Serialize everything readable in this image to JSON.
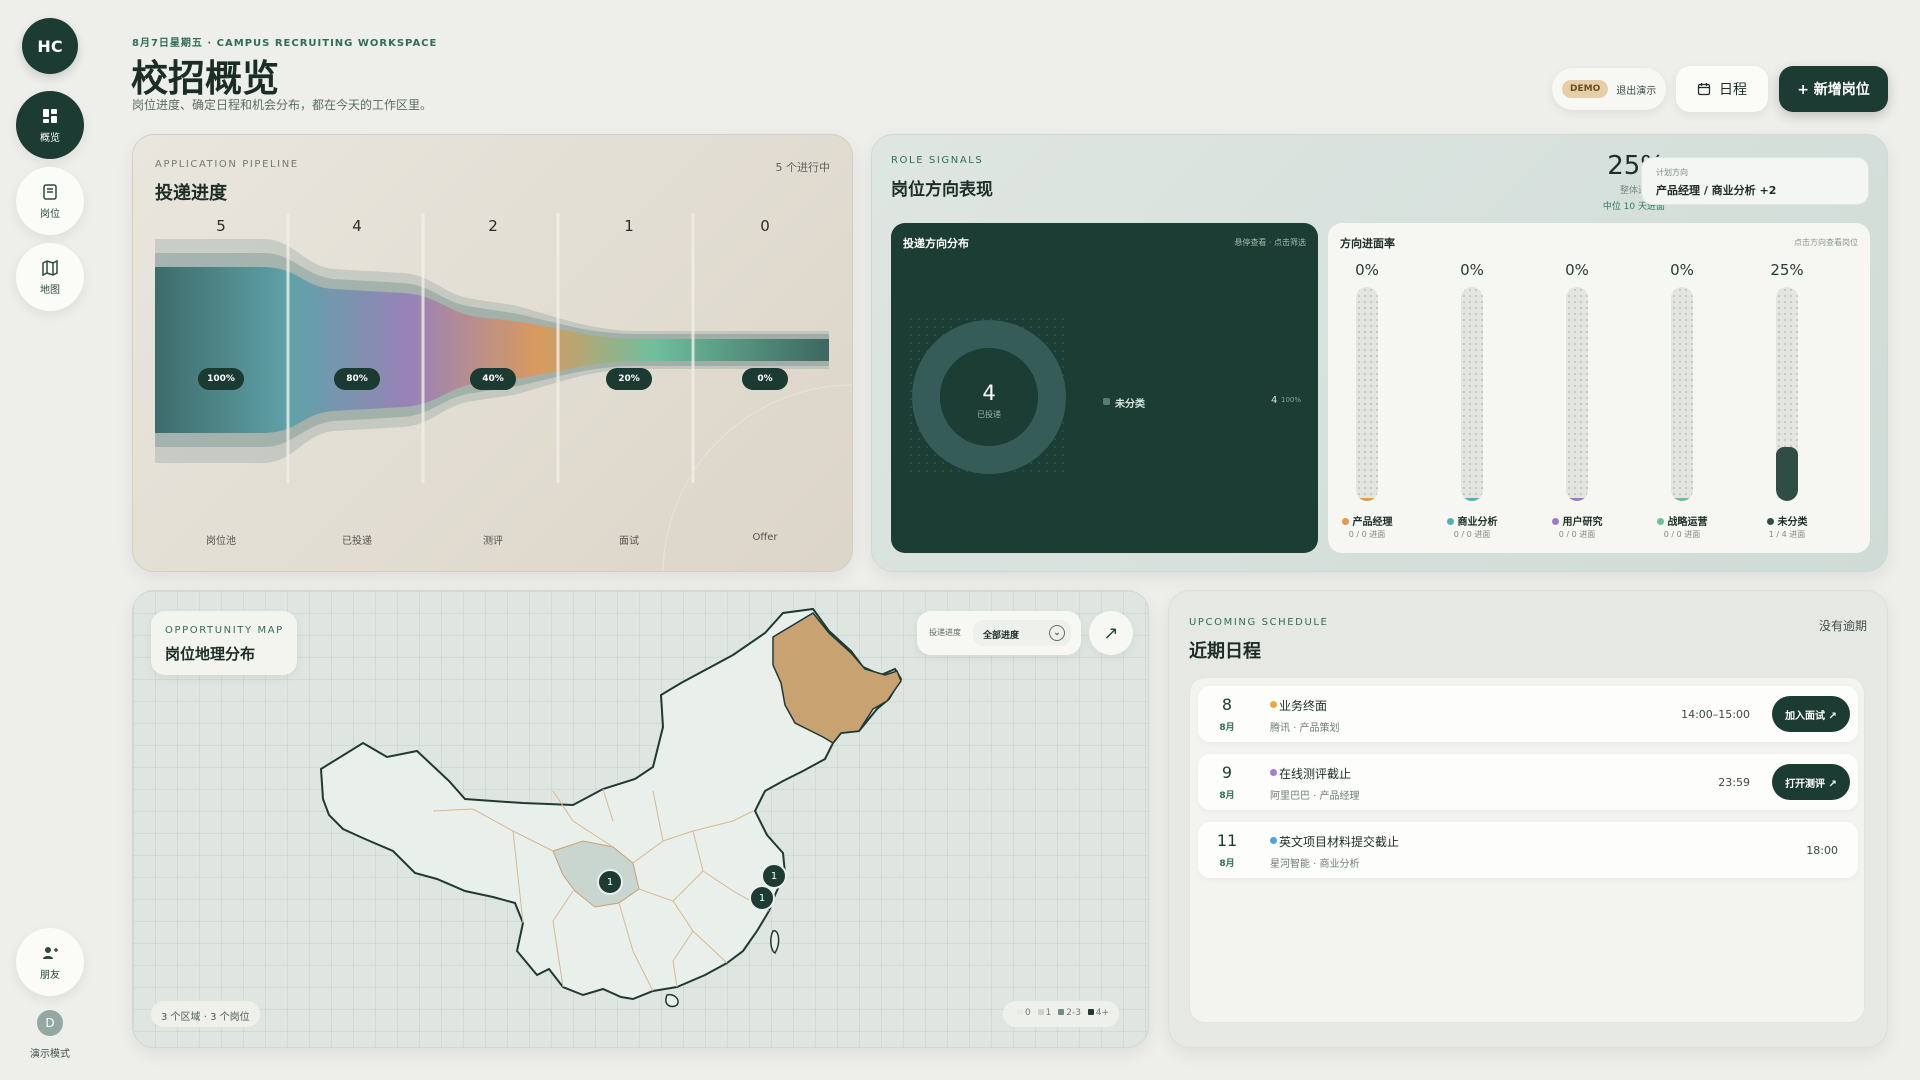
{
  "sidebar": {
    "logo": "HC",
    "items": [
      {
        "label": "概览",
        "icon": "dashboard-icon"
      },
      {
        "label": "岗位",
        "icon": "document-icon"
      },
      {
        "label": "地图",
        "icon": "map-icon"
      }
    ],
    "friends_label": "朋友",
    "user_initial": "D",
    "mode_label": "演示模式"
  },
  "header": {
    "eyebrow": "8月7日星期五 · CAMPUS RECRUITING WORKSPACE",
    "title": "校招概览",
    "subtitle": "岗位进度、确定日程和机会分布，都在今天的工作区里。",
    "demo_badge": "DEMO",
    "demo_exit": "退出演示",
    "schedule_btn": "日程",
    "new_btn": "+ 新增岗位"
  },
  "pipeline": {
    "kicker": "APPLICATION PIPELINE",
    "title": "投递进度",
    "status": "5 个进行中",
    "stages": [
      {
        "count": "5",
        "pct": "100%",
        "label": "岗位池"
      },
      {
        "count": "4",
        "pct": "80%",
        "label": "已投递"
      },
      {
        "count": "2",
        "pct": "40%",
        "label": "测评"
      },
      {
        "count": "1",
        "pct": "20%",
        "label": "面试"
      },
      {
        "count": "0",
        "pct": "0%",
        "label": "Offer"
      }
    ]
  },
  "roles": {
    "kicker": "ROLE SIGNALS",
    "title": "岗位方向表现",
    "overall_pct": "25%",
    "overall_label": "整体进面率",
    "median_label": "中位 10 天进面",
    "plan_label": "计划方向",
    "plan_value": "产品经理 / 商业分析 +2",
    "dist_title": "投递方向分布",
    "dist_hint": "悬停查看 · 点击筛选",
    "donut_value": "4",
    "donut_label": "已投递",
    "legend_name": "未分类",
    "legend_count": "4",
    "legend_pct": "100%",
    "rate_title": "方向进面率",
    "rate_hint": "点击方向查看岗位",
    "columns": [
      {
        "pct": "0%",
        "fill": 0,
        "name": "产品经理",
        "sub": "0 / 0 进面",
        "color": "#e0994f"
      },
      {
        "pct": "0%",
        "fill": 0,
        "name": "商业分析",
        "sub": "0 / 0 进面",
        "color": "#4fb3b0"
      },
      {
        "pct": "0%",
        "fill": 0,
        "name": "用户研究",
        "sub": "0 / 0 进面",
        "color": "#9b7bc8"
      },
      {
        "pct": "0%",
        "fill": 0,
        "name": "战略运营",
        "sub": "0 / 0 进面",
        "color": "#6bbf95"
      },
      {
        "pct": "25%",
        "fill": 0.25,
        "name": "未分类",
        "sub": "1 / 4 进面",
        "color": "#2f4c45"
      }
    ]
  },
  "map": {
    "kicker": "OPPORTUNITY MAP",
    "title": "岗位地理分布",
    "filter_label": "投递进度",
    "filter_value": "全部进度",
    "summary": "3 个区域 · 3 个岗位",
    "legend": [
      "0",
      "1",
      "2-3",
      "4+"
    ],
    "markers": [
      "1",
      "1",
      "1"
    ]
  },
  "schedule": {
    "kicker": "UPCOMING SCHEDULE",
    "title": "近期日程",
    "status": "没有逾期",
    "events": [
      {
        "day": "8",
        "month": "8月",
        "title": "业务终面",
        "sub": "腾讯 · 产品策划",
        "time": "14:00–15:00",
        "button": "加入面试 ↗",
        "color": "#f0a640"
      },
      {
        "day": "9",
        "month": "8月",
        "title": "在线测评截止",
        "sub": "阿里巴巴 · 产品经理",
        "time": "23:59",
        "button": "打开测评 ↗",
        "color": "#a57ad8"
      },
      {
        "day": "11",
        "month": "8月",
        "title": "英文项目材料提交截止",
        "sub": "星河智能 · 商业分析",
        "time": "18:00",
        "button": "",
        "color": "#4aa6e0"
      }
    ]
  }
}
